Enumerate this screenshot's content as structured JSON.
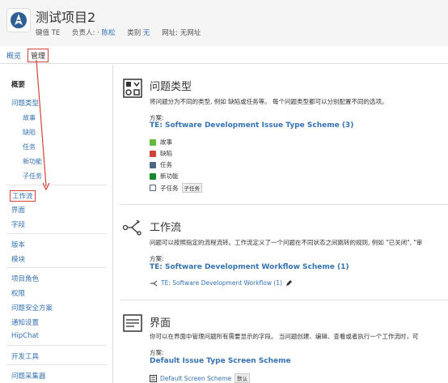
{
  "project": {
    "title": "测试项目2",
    "key_label": "键值",
    "key_value": "TE",
    "lead_label": "负责人:",
    "lead_value": "陈松",
    "category_label": "类别",
    "category_value": "无",
    "url_label": "网址:",
    "url_value": "无网址"
  },
  "nav": {
    "overview": "概览",
    "manage": "管理"
  },
  "sidebar": {
    "summary": "概要",
    "issue_types": "问题类型",
    "sub_types": [
      "故事",
      "缺陷",
      "任务",
      "新功能",
      "子任务"
    ],
    "workflows": "工作流",
    "screens": "界面",
    "fields": "字段",
    "versions": "版本",
    "components": "模块",
    "roles": "项目角色",
    "permissions": "权限",
    "security": "问题安全方案",
    "notifications": "通知设置",
    "hipchat": "HipChat",
    "dev_tools": "开发工具",
    "collectors": "问题采集器"
  },
  "sections": {
    "issue_types": {
      "title": "问题类型",
      "desc": "将问题分为不同的类型, 例如 缺陷或任务等。 每个问题类型都可以分别配置不同的选项。",
      "scheme_label": "方案:",
      "scheme": "TE: Software Development Issue Type Scheme (3)",
      "types": [
        "故事",
        "缺陷",
        "任务",
        "新功能",
        "子任务"
      ],
      "subtask_badge": "子任务"
    },
    "workflows": {
      "title": "工作流",
      "desc": "问题可以按照指定的流程流转。工作流定义了一个问题在不同状态之间跳转的规则, 例如 \"已关闭\", \"审",
      "scheme_label": "方案:",
      "scheme": "TE: Software Development Workflow Scheme (1)",
      "workflow": "TE: Software Development Workflow (1)"
    },
    "screens": {
      "title": "界面",
      "desc": "你可以在界面中管理问题所有需要显示的字段。 当问题创建、编辑、查看或者执行一个工作流时，可",
      "scheme_label": "方案:",
      "scheme": "Default Issue Type Screen Scheme",
      "screen": "Default Screen Scheme",
      "default_badge": "默认"
    }
  },
  "colors": {
    "accent": "#3572b0",
    "highlight": "#d04437"
  },
  "icons": [
    "rocket-icon",
    "issue-types-icon",
    "workflow-icon",
    "screens-icon",
    "edit-pencil-icon"
  ]
}
